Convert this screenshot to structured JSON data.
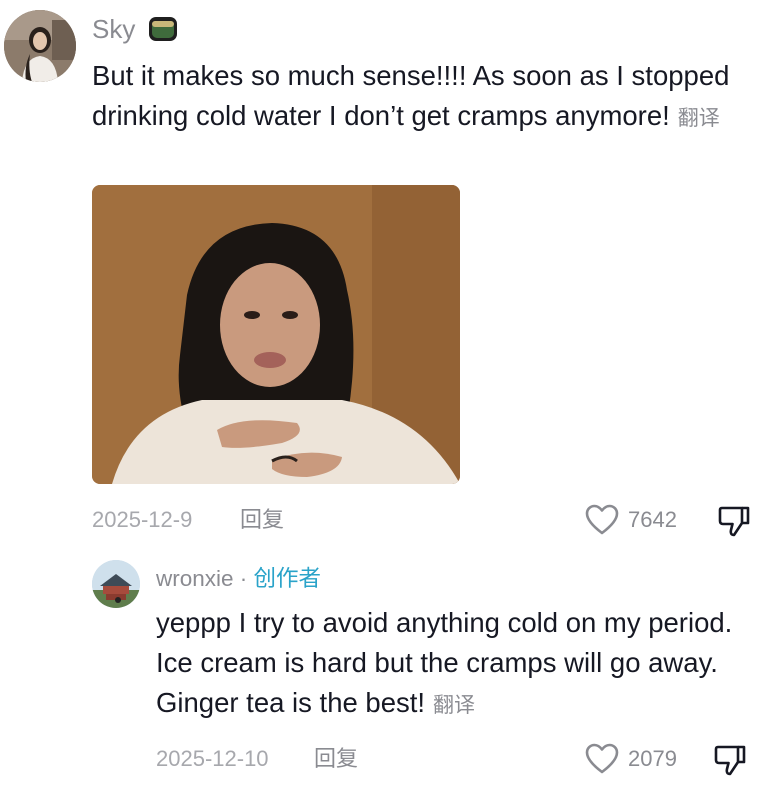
{
  "comments": [
    {
      "username": "Sky",
      "badge_icon": "emoji-badge-icon",
      "text": "But it makes so much sense!!!! As soon as I stopped drinking cold water I don’t get cramps anymore!",
      "translate_label": "翻译",
      "date": "2025-12-9",
      "reply_label": "回复",
      "likes": "7642"
    },
    {
      "username": "wronxie",
      "separator": " · ",
      "creator_label": "创作者",
      "text": "yeppp I try to avoid anything cold on my period. Ice cream is hard but the cramps will go away. Ginger tea is the best!",
      "translate_label": "翻译",
      "date": "2025-12-10",
      "reply_label": "回复",
      "likes": "2079"
    }
  ],
  "colors": {
    "text": "#161823",
    "muted": "#8a8b91",
    "creator_accent": "#2aa3c9"
  }
}
